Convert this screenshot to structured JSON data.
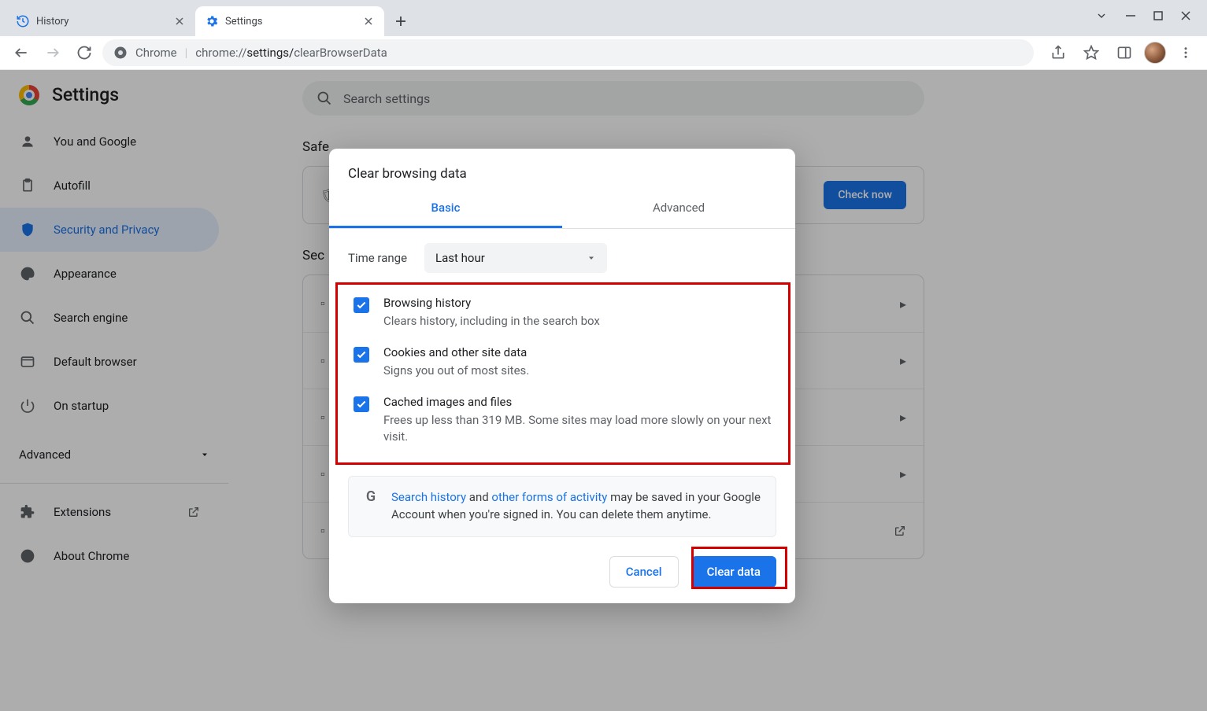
{
  "tabs": [
    {
      "title": "History"
    },
    {
      "title": "Settings"
    }
  ],
  "url": {
    "prefix": "Chrome",
    "gray1": "chrome://",
    "dark": "settings/",
    "gray2": "clearBrowserData"
  },
  "pageTitle": "Settings",
  "search": {
    "placeholder": "Search settings"
  },
  "sidebar": [
    {
      "label": "You and Google"
    },
    {
      "label": "Autofill"
    },
    {
      "label": "Security and Privacy"
    },
    {
      "label": "Appearance"
    },
    {
      "label": "Search engine"
    },
    {
      "label": "Default browser"
    },
    {
      "label": "On startup"
    }
  ],
  "advLabel": "Advanced",
  "sidebar2": [
    {
      "label": "Extensions"
    },
    {
      "label": "About Chrome"
    }
  ],
  "sections": {
    "safe": {
      "head": "Safe",
      "check": "Check now"
    },
    "sec": {
      "head": "Sec"
    }
  },
  "dialog": {
    "title": "Clear browsing data",
    "tabs": {
      "basic": "Basic",
      "advanced": "Advanced"
    },
    "timeRange": {
      "label": "Time range",
      "value": "Last hour"
    },
    "opts": [
      {
        "t": "Browsing history",
        "d": "Clears history, including in the search box"
      },
      {
        "t": "Cookies and other site data",
        "d": "Signs you out of most sites."
      },
      {
        "t": "Cached images and files",
        "d": "Frees up less than 319 MB. Some sites may load more slowly on your next visit."
      }
    ],
    "info": {
      "link1": "Search history",
      "mid": " and ",
      "link2": "other forms of activity",
      "rest": " may be saved in your Google Account when you're signed in. You can delete them anytime."
    },
    "cancel": "Cancel",
    "clear": "Clear data"
  }
}
